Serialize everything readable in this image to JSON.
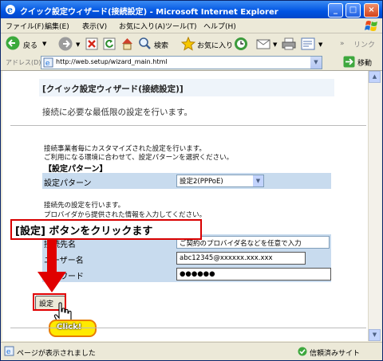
{
  "window": {
    "title": "クイック設定ウィザード(接続設定) - Microsoft Internet Explorer",
    "min": "_",
    "max": "□",
    "close": "×"
  },
  "menu": [
    "ファイル(F)",
    "編集(E)",
    "表示(V)",
    "お気に入り(A)",
    "ツール(T)",
    "ヘルプ(H)"
  ],
  "toolbar": {
    "back": "戻る",
    "search": "検索",
    "favorites": "お気に入り",
    "links": "リンク"
  },
  "address": {
    "label": "アドレス(D)",
    "url": "http://web.setup/wizard_main.html",
    "go": "移動"
  },
  "page": {
    "header": "[クイック設定ウィザード(接続設定)]",
    "lead": "接続に必要な最低限の設定を行います。",
    "intro1": "接続事業者毎にカスタマイズされた設定を行います。",
    "intro2": "ご利用になる環境に合わせて、設定パターンを選択ください。",
    "pattern_section": "【設定パターン】",
    "pattern_label": "設定パターン",
    "pattern_value": "設定2(PPPoE)",
    "conn_intro1": "接続先の設定を行います。",
    "conn_intro2": "プロバイダから提供された情報を入力してください。",
    "conn_name_label": "接続先名",
    "conn_name_value": "ご契約のプロバイダ名などを任意で入力",
    "user_label": "ユーザー名",
    "user_value": "abc12345@xxxxxx.xxx.xxx",
    "password_label": "パスワード",
    "password_value": "●●●●●●",
    "set_button": "設定"
  },
  "annotation": {
    "callout": "[設定] ボタンをクリックます",
    "click": "Click!"
  },
  "status": {
    "left": "ページが表示されました",
    "right": "信頼済みサイト"
  },
  "colors": {
    "title_bar": "#0054e3",
    "row_bg": "#c8dbee",
    "highlight": "#d80000",
    "click_badge": "#ffea00"
  }
}
